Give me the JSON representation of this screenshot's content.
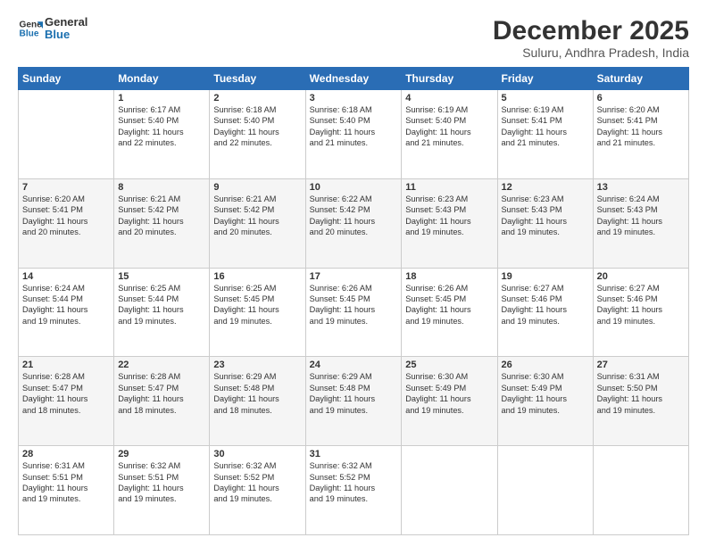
{
  "header": {
    "logo_line1": "General",
    "logo_line2": "Blue",
    "title": "December 2025",
    "subtitle": "Suluru, Andhra Pradesh, India"
  },
  "weekdays": [
    "Sunday",
    "Monday",
    "Tuesday",
    "Wednesday",
    "Thursday",
    "Friday",
    "Saturday"
  ],
  "weeks": [
    [
      {
        "day": "",
        "info": ""
      },
      {
        "day": "1",
        "info": "Sunrise: 6:17 AM\nSunset: 5:40 PM\nDaylight: 11 hours\nand 22 minutes."
      },
      {
        "day": "2",
        "info": "Sunrise: 6:18 AM\nSunset: 5:40 PM\nDaylight: 11 hours\nand 22 minutes."
      },
      {
        "day": "3",
        "info": "Sunrise: 6:18 AM\nSunset: 5:40 PM\nDaylight: 11 hours\nand 21 minutes."
      },
      {
        "day": "4",
        "info": "Sunrise: 6:19 AM\nSunset: 5:40 PM\nDaylight: 11 hours\nand 21 minutes."
      },
      {
        "day": "5",
        "info": "Sunrise: 6:19 AM\nSunset: 5:41 PM\nDaylight: 11 hours\nand 21 minutes."
      },
      {
        "day": "6",
        "info": "Sunrise: 6:20 AM\nSunset: 5:41 PM\nDaylight: 11 hours\nand 21 minutes."
      }
    ],
    [
      {
        "day": "7",
        "info": "Sunrise: 6:20 AM\nSunset: 5:41 PM\nDaylight: 11 hours\nand 20 minutes."
      },
      {
        "day": "8",
        "info": "Sunrise: 6:21 AM\nSunset: 5:42 PM\nDaylight: 11 hours\nand 20 minutes."
      },
      {
        "day": "9",
        "info": "Sunrise: 6:21 AM\nSunset: 5:42 PM\nDaylight: 11 hours\nand 20 minutes."
      },
      {
        "day": "10",
        "info": "Sunrise: 6:22 AM\nSunset: 5:42 PM\nDaylight: 11 hours\nand 20 minutes."
      },
      {
        "day": "11",
        "info": "Sunrise: 6:23 AM\nSunset: 5:43 PM\nDaylight: 11 hours\nand 19 minutes."
      },
      {
        "day": "12",
        "info": "Sunrise: 6:23 AM\nSunset: 5:43 PM\nDaylight: 11 hours\nand 19 minutes."
      },
      {
        "day": "13",
        "info": "Sunrise: 6:24 AM\nSunset: 5:43 PM\nDaylight: 11 hours\nand 19 minutes."
      }
    ],
    [
      {
        "day": "14",
        "info": "Sunrise: 6:24 AM\nSunset: 5:44 PM\nDaylight: 11 hours\nand 19 minutes."
      },
      {
        "day": "15",
        "info": "Sunrise: 6:25 AM\nSunset: 5:44 PM\nDaylight: 11 hours\nand 19 minutes."
      },
      {
        "day": "16",
        "info": "Sunrise: 6:25 AM\nSunset: 5:45 PM\nDaylight: 11 hours\nand 19 minutes."
      },
      {
        "day": "17",
        "info": "Sunrise: 6:26 AM\nSunset: 5:45 PM\nDaylight: 11 hours\nand 19 minutes."
      },
      {
        "day": "18",
        "info": "Sunrise: 6:26 AM\nSunset: 5:45 PM\nDaylight: 11 hours\nand 19 minutes."
      },
      {
        "day": "19",
        "info": "Sunrise: 6:27 AM\nSunset: 5:46 PM\nDaylight: 11 hours\nand 19 minutes."
      },
      {
        "day": "20",
        "info": "Sunrise: 6:27 AM\nSunset: 5:46 PM\nDaylight: 11 hours\nand 19 minutes."
      }
    ],
    [
      {
        "day": "21",
        "info": "Sunrise: 6:28 AM\nSunset: 5:47 PM\nDaylight: 11 hours\nand 18 minutes."
      },
      {
        "day": "22",
        "info": "Sunrise: 6:28 AM\nSunset: 5:47 PM\nDaylight: 11 hours\nand 18 minutes."
      },
      {
        "day": "23",
        "info": "Sunrise: 6:29 AM\nSunset: 5:48 PM\nDaylight: 11 hours\nand 18 minutes."
      },
      {
        "day": "24",
        "info": "Sunrise: 6:29 AM\nSunset: 5:48 PM\nDaylight: 11 hours\nand 19 minutes."
      },
      {
        "day": "25",
        "info": "Sunrise: 6:30 AM\nSunset: 5:49 PM\nDaylight: 11 hours\nand 19 minutes."
      },
      {
        "day": "26",
        "info": "Sunrise: 6:30 AM\nSunset: 5:49 PM\nDaylight: 11 hours\nand 19 minutes."
      },
      {
        "day": "27",
        "info": "Sunrise: 6:31 AM\nSunset: 5:50 PM\nDaylight: 11 hours\nand 19 minutes."
      }
    ],
    [
      {
        "day": "28",
        "info": "Sunrise: 6:31 AM\nSunset: 5:51 PM\nDaylight: 11 hours\nand 19 minutes."
      },
      {
        "day": "29",
        "info": "Sunrise: 6:32 AM\nSunset: 5:51 PM\nDaylight: 11 hours\nand 19 minutes."
      },
      {
        "day": "30",
        "info": "Sunrise: 6:32 AM\nSunset: 5:52 PM\nDaylight: 11 hours\nand 19 minutes."
      },
      {
        "day": "31",
        "info": "Sunrise: 6:32 AM\nSunset: 5:52 PM\nDaylight: 11 hours\nand 19 minutes."
      },
      {
        "day": "",
        "info": ""
      },
      {
        "day": "",
        "info": ""
      },
      {
        "day": "",
        "info": ""
      }
    ]
  ]
}
